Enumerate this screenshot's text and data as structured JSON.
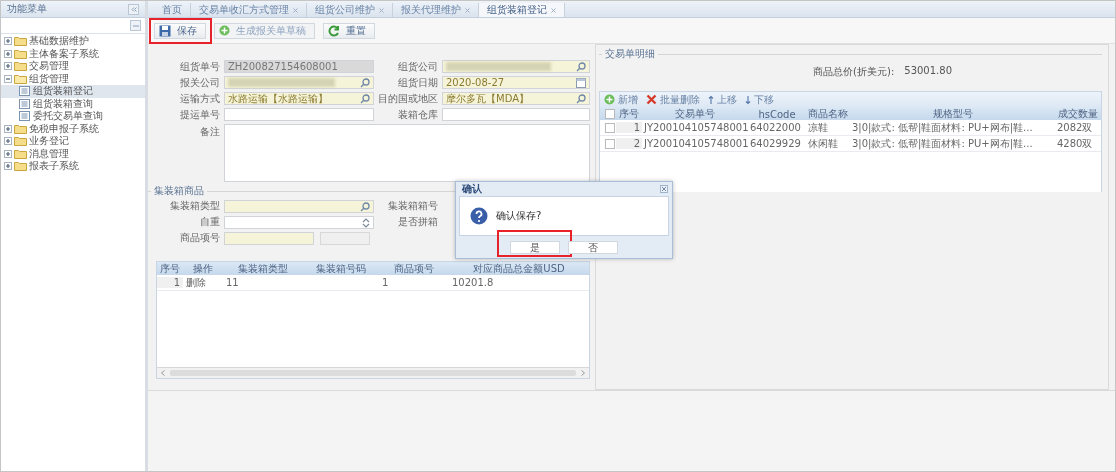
{
  "sidebar": {
    "title": "功能菜单",
    "items": [
      {
        "label": "基础数据维护",
        "expanded": false
      },
      {
        "label": "主体备案子系统",
        "expanded": false
      },
      {
        "label": "交易管理",
        "expanded": false
      },
      {
        "label": "组货管理",
        "expanded": true,
        "children": [
          {
            "label": "组货装箱登记",
            "selected": true
          },
          {
            "label": "组货装箱查询",
            "selected": false
          },
          {
            "label": "委托交易单查询",
            "selected": false
          }
        ]
      },
      {
        "label": "免税申报子系统",
        "expanded": false
      },
      {
        "label": "业务登记",
        "expanded": false
      },
      {
        "label": "消息管理",
        "expanded": false
      },
      {
        "label": "报表子系统",
        "expanded": false
      }
    ]
  },
  "tabs": [
    {
      "label": "首页",
      "selected": false,
      "closable": false
    },
    {
      "label": "交易单收汇方式管理",
      "selected": false,
      "closable": true
    },
    {
      "label": "组货公司维护",
      "selected": false,
      "closable": true
    },
    {
      "label": "报关代理维护",
      "selected": false,
      "closable": true
    },
    {
      "label": "组货装箱登记",
      "selected": true,
      "closable": true
    }
  ],
  "toolbar": [
    {
      "label": "保存",
      "disabled": false,
      "highlighted": true
    },
    {
      "label": "生成报关单草稿",
      "disabled": true,
      "highlighted": false
    },
    {
      "label": "重置",
      "disabled": false,
      "highlighted": false
    }
  ],
  "form": {
    "fields": [
      {
        "label": "组货单号",
        "value": "ZH200827154608001",
        "kind": "readonly"
      },
      {
        "label": "组货公司",
        "kind": "lookup",
        "required": true,
        "redacted": true
      },
      {
        "label": "报关公司",
        "kind": "lookup",
        "required": true,
        "redacted": true
      },
      {
        "label": "组货日期",
        "value": "2020-08-27",
        "kind": "date",
        "required": true
      },
      {
        "label": "运输方式",
        "value": "水路运输【水路运输】",
        "kind": "lookup",
        "required": true
      },
      {
        "label": "目的国或地区",
        "value": "摩尔多瓦【MDA】",
        "kind": "lookup",
        "required": true
      },
      {
        "label": "提运单号",
        "kind": "text",
        "required": false
      },
      {
        "label": "装箱仓库",
        "kind": "text",
        "required": false
      },
      {
        "label": "备注",
        "kind": "textarea",
        "required": false
      }
    ]
  },
  "container_section": {
    "title": "集装箱商品",
    "fields": [
      {
        "label": "集装箱类型",
        "kind": "lookup",
        "required": true
      },
      {
        "label": "集装箱箱号"
      },
      {
        "label": "自重",
        "kind": "spinner",
        "required": false
      },
      {
        "label": "是否拼箱"
      },
      {
        "label": "商品项号",
        "kind": "picker",
        "required": true
      }
    ],
    "table": {
      "columns": [
        "序号",
        "操作",
        "集装箱类型",
        "集装箱号码",
        "商品项号",
        "对应商品总金额USD"
      ],
      "rows": [
        {
          "index": "1",
          "action": "删除",
          "container_type": "11",
          "container_no": "",
          "item_no": "1",
          "amount": "10201.8"
        }
      ]
    }
  },
  "trade_section": {
    "title": "交易单明细",
    "total_label": "商品总价(折美元):",
    "total_value": "53001.80",
    "actions": [
      {
        "label": "新增"
      },
      {
        "label": "批量删除"
      },
      {
        "label": "上移"
      },
      {
        "label": "下移"
      }
    ],
    "table": {
      "all_checked": false,
      "columns": [
        "序号",
        "交易单号",
        "hsCode",
        "商品名称",
        "规格型号",
        "成交数量"
      ],
      "rows": [
        {
          "checked": false,
          "index": "1",
          "trade_no": "JY200104105748001",
          "hs_code": "64022000",
          "name": "凉鞋",
          "spec": "3|0|款式: 低帮|鞋面材料: PU+网布|鞋...",
          "quantity": "2082双"
        },
        {
          "checked": false,
          "index": "2",
          "trade_no": "JY200104105748001",
          "hs_code": "64029929",
          "name": "休闲鞋",
          "spec": "3|0|款式: 低帮|鞋面材料: PU+网布|鞋...",
          "quantity": "4280双"
        }
      ]
    }
  },
  "dialog": {
    "title": "确认",
    "message": "确认保存?",
    "buttons": [
      {
        "label": "是",
        "highlighted": true
      },
      {
        "label": "否",
        "highlighted": false
      }
    ]
  }
}
